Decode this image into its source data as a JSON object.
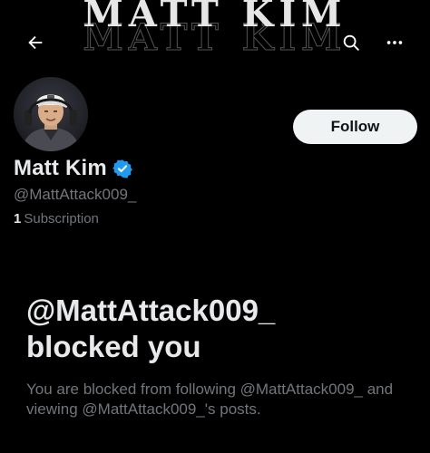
{
  "banner": {
    "title": "MATT KIM"
  },
  "topbar": {
    "back_icon": "back-arrow-icon",
    "search_icon": "search-icon",
    "more_icon": "more-options-icon"
  },
  "profile": {
    "display_name": "Matt Kim",
    "verified_icon": "verified-badge-icon",
    "verified_color": "#1d9bf0",
    "handle": "@MattAttack009_",
    "subscriptions_count": "1",
    "subscriptions_label": "Subscription",
    "follow_label": "Follow"
  },
  "blocked": {
    "title_line1": "@MattAttack009_",
    "title_line2": "blocked you",
    "description": "You are blocked from following @MattAttack009_ and viewing @MattAttack009_'s posts."
  },
  "colors": {
    "background": "#000000",
    "primary_text": "#e7e9ea",
    "secondary_text": "#71767b",
    "button_bg": "#eff3f4"
  }
}
